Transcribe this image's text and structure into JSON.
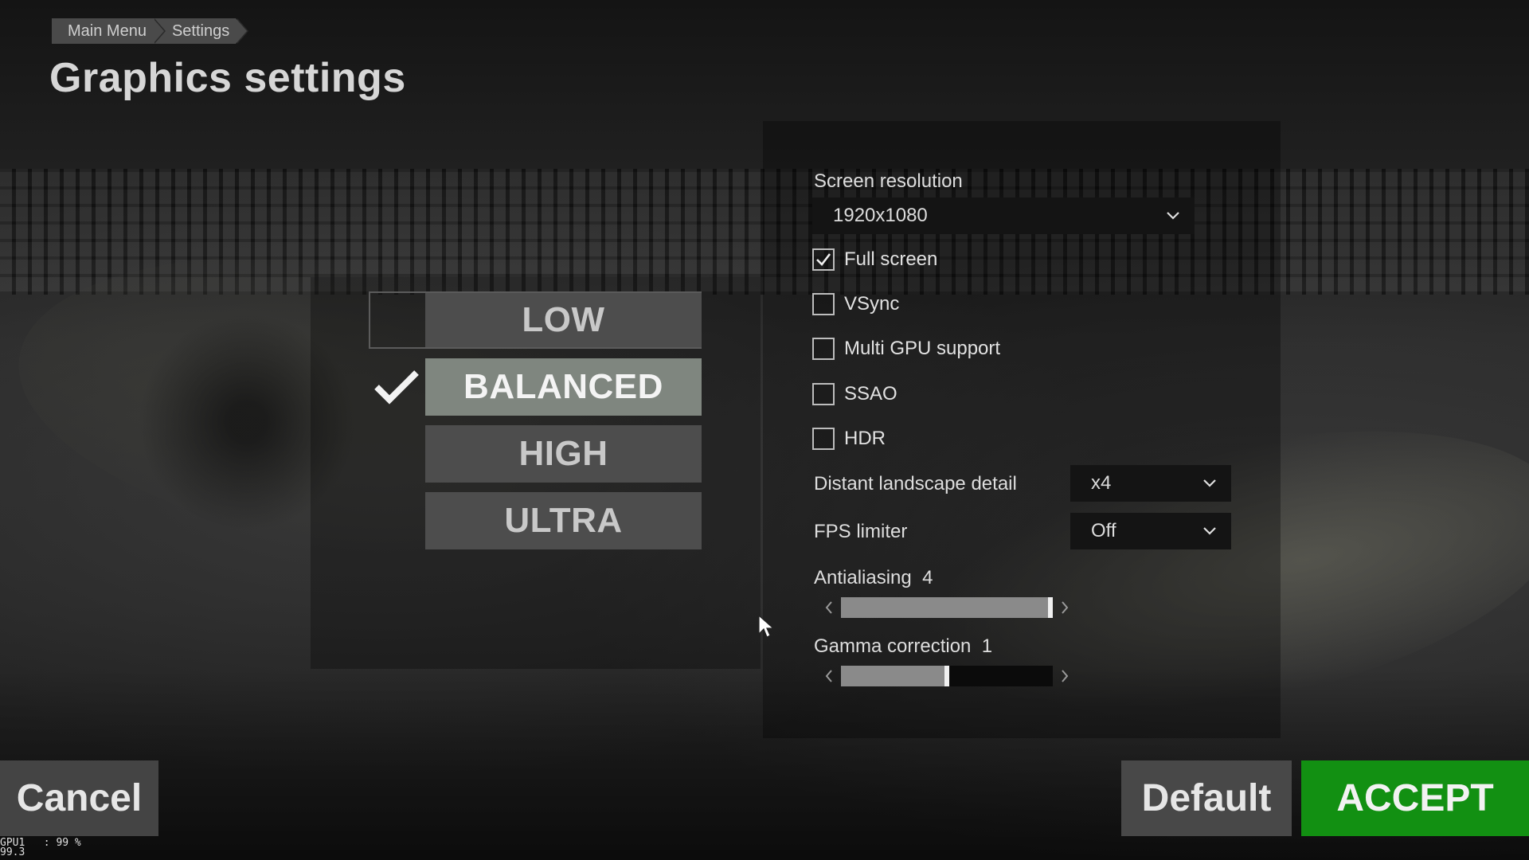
{
  "breadcrumb": [
    "Main Menu",
    "Settings"
  ],
  "page_title": "Graphics settings",
  "presets": [
    {
      "label": "LOW",
      "selected": false
    },
    {
      "label": "BALANCED",
      "selected": true
    },
    {
      "label": "HIGH",
      "selected": false
    },
    {
      "label": "ULTRA",
      "selected": false
    }
  ],
  "settings": {
    "resolution_label": "Screen resolution",
    "resolution_value": "1920x1080",
    "checkboxes": [
      {
        "label": "Full screen",
        "checked": true
      },
      {
        "label": "VSync",
        "checked": false
      },
      {
        "label": "Multi GPU support",
        "checked": false
      },
      {
        "label": "SSAO",
        "checked": false
      },
      {
        "label": "HDR",
        "checked": false
      }
    ],
    "distant_label": "Distant landscape detail",
    "distant_value": "x4",
    "fps_label": "FPS limiter",
    "fps_value": "Off",
    "antialiasing_label": "Antialiasing",
    "antialiasing_value": "4",
    "antialiasing_level": 1.0,
    "gamma_label": "Gamma correction",
    "gamma_value": "1",
    "gamma_level": 0.5
  },
  "buttons": {
    "cancel": "Cancel",
    "default": "Default",
    "accept": "ACCEPT"
  },
  "overlay": {
    "gpu_line1": "GPU1   : 99 %",
    "gpu_line2": "99.3"
  },
  "colors": {
    "accept": "#129012",
    "preset_selected": "#7f867f",
    "preset": "#4d4d4d"
  }
}
